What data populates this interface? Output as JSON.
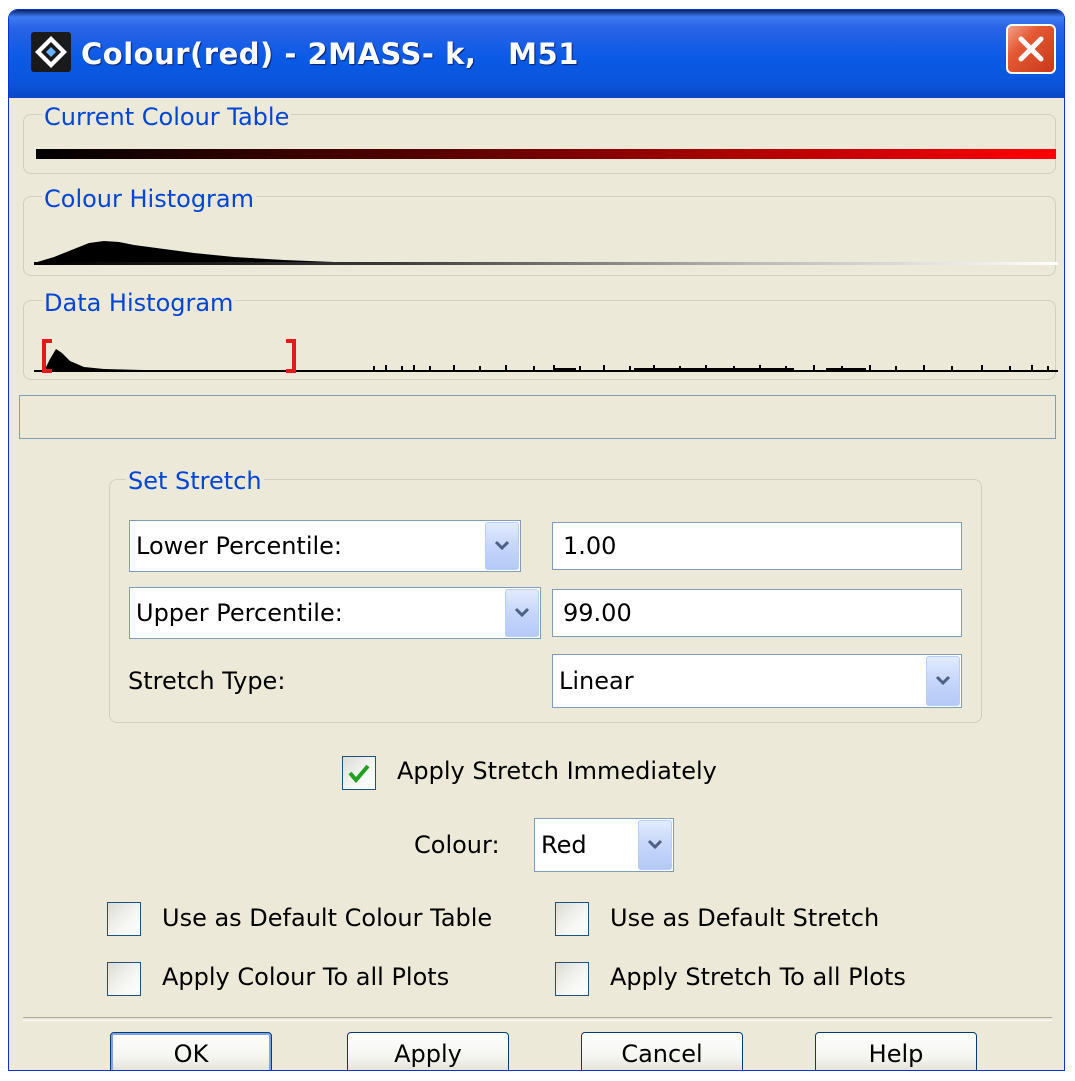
{
  "window": {
    "title": "Colour(red) - 2MASS- k,   M51"
  },
  "panels": {
    "current_colour_table": "Current Colour Table",
    "colour_histogram": "Colour Histogram",
    "data_histogram": "Data Histogram"
  },
  "set_stretch": {
    "legend": "Set Stretch",
    "lower_select": "Lower Percentile:",
    "lower_value": "1.00",
    "upper_select": "Upper Percentile:",
    "upper_value": "99.00",
    "stretch_type_label": "Stretch Type:",
    "stretch_type_value": "Linear"
  },
  "options": {
    "apply_immediately": {
      "label": "Apply Stretch Immediately",
      "checked": true
    },
    "colour_label": "Colour:",
    "colour_value": "Red",
    "default_colour_table": {
      "label": "Use as Default Colour Table",
      "checked": false
    },
    "default_stretch": {
      "label": "Use as Default Stretch",
      "checked": false
    },
    "apply_colour_all": {
      "label": "Apply Colour To all Plots",
      "checked": false
    },
    "apply_stretch_all": {
      "label": "Apply Stretch To all Plots",
      "checked": false
    }
  },
  "buttons": {
    "ok": "OK",
    "apply": "Apply",
    "cancel": "Cancel",
    "help": "Help"
  },
  "colors": {
    "title_bar": "#0a5ae6",
    "legend_text": "#0046d5",
    "colour_table_end": "#ff0000",
    "check_mark": "#21a121"
  },
  "icons": [
    "app-icon",
    "close-icon",
    "chevron-down-icon",
    "check-mark-icon"
  ]
}
